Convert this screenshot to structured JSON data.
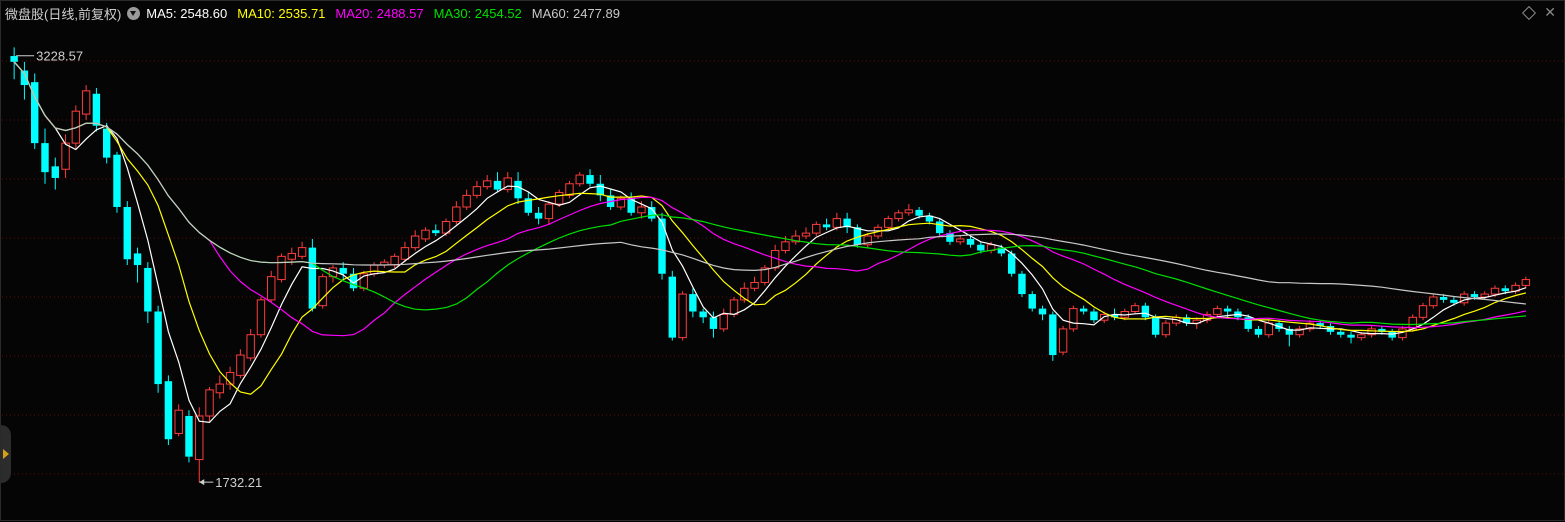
{
  "header": {
    "title": "微盘股(日线,前复权)",
    "ma": [
      {
        "label": "MA5: 2548.60",
        "color": "#ffffff"
      },
      {
        "label": "MA10: 2535.71",
        "color": "#ffff00"
      },
      {
        "label": "MA20: 2488.57",
        "color": "#ff00ff"
      },
      {
        "label": "MA30: 2454.52",
        "color": "#00e000"
      },
      {
        "label": "MA60: 2477.89",
        "color": "#c8c8c8"
      }
    ]
  },
  "chart_data": {
    "type": "candlestick",
    "ylim": [
      1650,
      3300
    ],
    "grid": true,
    "colors": {
      "up": "#ff3c3c",
      "down": "#00ffff"
    },
    "annotations": {
      "high": "3228.57",
      "low": "1732.21"
    },
    "high_value": 3228.57,
    "low_value": 1732.21,
    "candles": [
      [
        3200,
        3180,
        3230,
        3120
      ],
      [
        3150,
        3100,
        3180,
        3050
      ],
      [
        3110,
        2900,
        3140,
        2880
      ],
      [
        2900,
        2800,
        2950,
        2760
      ],
      [
        2820,
        2780,
        2850,
        2740
      ],
      [
        2810,
        2900,
        2930,
        2780
      ],
      [
        2900,
        3010,
        3030,
        2880
      ],
      [
        3000,
        3080,
        3100,
        2980
      ],
      [
        3070,
        2960,
        3090,
        2940
      ],
      [
        2950,
        2850,
        2970,
        2830
      ],
      [
        2860,
        2680,
        2870,
        2660
      ],
      [
        2680,
        2500,
        2700,
        2480
      ],
      [
        2520,
        2480,
        2540,
        2420
      ],
      [
        2470,
        2320,
        2490,
        2280
      ],
      [
        2320,
        2070,
        2340,
        2040
      ],
      [
        2080,
        1880,
        2100,
        1860
      ],
      [
        1900,
        1980,
        2000,
        1890
      ],
      [
        1960,
        1820,
        1980,
        1800
      ],
      [
        1810,
        1960,
        1990,
        1732.21
      ],
      [
        1960,
        2050,
        2060,
        1940
      ],
      [
        2040,
        2070,
        2100,
        2020
      ],
      [
        2070,
        2110,
        2130,
        2050
      ],
      [
        2100,
        2170,
        2190,
        2090
      ],
      [
        2160,
        2240,
        2260,
        2150
      ],
      [
        2240,
        2360,
        2370,
        2230
      ],
      [
        2360,
        2440,
        2460,
        2350
      ],
      [
        2430,
        2510,
        2520,
        2420
      ],
      [
        2500,
        2520,
        2540,
        2480
      ],
      [
        2510,
        2540,
        2560,
        2500
      ],
      [
        2540,
        2330,
        2570,
        2320
      ],
      [
        2340,
        2440,
        2450,
        2330
      ],
      [
        2440,
        2470,
        2480,
        2420
      ],
      [
        2470,
        2450,
        2490,
        2430
      ],
      [
        2450,
        2400,
        2470,
        2390
      ],
      [
        2400,
        2450,
        2460,
        2390
      ],
      [
        2450,
        2480,
        2490,
        2440
      ],
      [
        2480,
        2490,
        2500,
        2470
      ],
      [
        2480,
        2510,
        2520,
        2470
      ],
      [
        2500,
        2540,
        2560,
        2490
      ],
      [
        2540,
        2580,
        2600,
        2530
      ],
      [
        2570,
        2600,
        2610,
        2560
      ],
      [
        2600,
        2590,
        2620,
        2580
      ],
      [
        2590,
        2630,
        2640,
        2580
      ],
      [
        2630,
        2680,
        2700,
        2620
      ],
      [
        2680,
        2720,
        2740,
        2670
      ],
      [
        2720,
        2750,
        2770,
        2710
      ],
      [
        2750,
        2770,
        2790,
        2740
      ],
      [
        2770,
        2740,
        2800,
        2730
      ],
      [
        2740,
        2780,
        2800,
        2730
      ],
      [
        2770,
        2710,
        2800,
        2690
      ],
      [
        2710,
        2660,
        2730,
        2650
      ],
      [
        2660,
        2640,
        2680,
        2620
      ],
      [
        2640,
        2690,
        2700,
        2620
      ],
      [
        2690,
        2730,
        2740,
        2680
      ],
      [
        2720,
        2760,
        2770,
        2710
      ],
      [
        2760,
        2790,
        2800,
        2750
      ],
      [
        2790,
        2760,
        2810,
        2750
      ],
      [
        2760,
        2720,
        2790,
        2700
      ],
      [
        2720,
        2680,
        2740,
        2670
      ],
      [
        2680,
        2710,
        2720,
        2670
      ],
      [
        2710,
        2660,
        2730,
        2650
      ],
      [
        2660,
        2680,
        2700,
        2640
      ],
      [
        2680,
        2640,
        2700,
        2630
      ],
      [
        2640,
        2450,
        2660,
        2430
      ],
      [
        2440,
        2230,
        2460,
        2220
      ],
      [
        2230,
        2380,
        2390,
        2220
      ],
      [
        2380,
        2320,
        2400,
        2300
      ],
      [
        2320,
        2300,
        2330,
        2280
      ],
      [
        2300,
        2260,
        2320,
        2230
      ],
      [
        2260,
        2310,
        2330,
        2250
      ],
      [
        2310,
        2360,
        2370,
        2300
      ],
      [
        2360,
        2400,
        2420,
        2350
      ],
      [
        2400,
        2420,
        2440,
        2390
      ],
      [
        2420,
        2470,
        2480,
        2410
      ],
      [
        2470,
        2530,
        2550,
        2460
      ],
      [
        2530,
        2560,
        2580,
        2520
      ],
      [
        2560,
        2580,
        2600,
        2550
      ],
      [
        2580,
        2590,
        2610,
        2570
      ],
      [
        2590,
        2620,
        2630,
        2580
      ],
      [
        2620,
        2610,
        2640,
        2600
      ],
      [
        2610,
        2640,
        2660,
        2600
      ],
      [
        2640,
        2610,
        2660,
        2590
      ],
      [
        2610,
        2550,
        2620,
        2540
      ],
      [
        2550,
        2580,
        2590,
        2540
      ],
      [
        2580,
        2610,
        2620,
        2570
      ],
      [
        2610,
        2640,
        2650,
        2600
      ],
      [
        2640,
        2660,
        2670,
        2630
      ],
      [
        2660,
        2670,
        2690,
        2650
      ],
      [
        2670,
        2650,
        2680,
        2640
      ],
      [
        2650,
        2630,
        2660,
        2620
      ],
      [
        2630,
        2590,
        2640,
        2580
      ],
      [
        2590,
        2560,
        2600,
        2550
      ],
      [
        2560,
        2570,
        2580,
        2550
      ],
      [
        2570,
        2550,
        2580,
        2540
      ],
      [
        2550,
        2530,
        2560,
        2520
      ],
      [
        2530,
        2550,
        2560,
        2520
      ],
      [
        2540,
        2520,
        2550,
        2510
      ],
      [
        2520,
        2450,
        2530,
        2440
      ],
      [
        2450,
        2380,
        2460,
        2370
      ],
      [
        2380,
        2330,
        2390,
        2320
      ],
      [
        2330,
        2310,
        2340,
        2290
      ],
      [
        2310,
        2170,
        2320,
        2150
      ],
      [
        2180,
        2260,
        2270,
        2170
      ],
      [
        2260,
        2330,
        2340,
        2250
      ],
      [
        2330,
        2320,
        2340,
        2310
      ],
      [
        2320,
        2290,
        2330,
        2280
      ],
      [
        2290,
        2310,
        2320,
        2280
      ],
      [
        2310,
        2300,
        2330,
        2290
      ],
      [
        2300,
        2320,
        2330,
        2290
      ],
      [
        2320,
        2340,
        2350,
        2310
      ],
      [
        2340,
        2300,
        2350,
        2290
      ],
      [
        2300,
        2240,
        2310,
        2230
      ],
      [
        2240,
        2280,
        2290,
        2230
      ],
      [
        2280,
        2300,
        2310,
        2270
      ],
      [
        2300,
        2280,
        2310,
        2270
      ],
      [
        2280,
        2290,
        2300,
        2260
      ],
      [
        2290,
        2310,
        2320,
        2280
      ],
      [
        2310,
        2330,
        2340,
        2300
      ],
      [
        2330,
        2320,
        2340,
        2300
      ],
      [
        2320,
        2300,
        2330,
        2290
      ],
      [
        2300,
        2260,
        2310,
        2250
      ],
      [
        2260,
        2240,
        2270,
        2230
      ],
      [
        2240,
        2280,
        2290,
        2230
      ],
      [
        2280,
        2260,
        2290,
        2250
      ],
      [
        2260,
        2240,
        2270,
        2200
      ],
      [
        2240,
        2260,
        2270,
        2230
      ],
      [
        2260,
        2280,
        2290,
        2250
      ],
      [
        2280,
        2270,
        2290,
        2260
      ],
      [
        2270,
        2250,
        2280,
        2240
      ],
      [
        2250,
        2240,
        2260,
        2230
      ],
      [
        2240,
        2230,
        2250,
        2210
      ],
      [
        2230,
        2240,
        2250,
        2220
      ],
      [
        2240,
        2260,
        2270,
        2230
      ],
      [
        2260,
        2250,
        2270,
        2240
      ],
      [
        2250,
        2230,
        2260,
        2220
      ],
      [
        2230,
        2260,
        2270,
        2220
      ],
      [
        2260,
        2300,
        2310,
        2250
      ],
      [
        2300,
        2340,
        2350,
        2290
      ],
      [
        2340,
        2370,
        2380,
        2330
      ],
      [
        2370,
        2360,
        2380,
        2350
      ],
      [
        2360,
        2350,
        2370,
        2340
      ],
      [
        2350,
        2380,
        2390,
        2340
      ],
      [
        2380,
        2370,
        2390,
        2360
      ],
      [
        2370,
        2380,
        2390,
        2360
      ],
      [
        2380,
        2400,
        2410,
        2370
      ],
      [
        2400,
        2390,
        2410,
        2380
      ],
      [
        2390,
        2410,
        2420,
        2380
      ],
      [
        2410,
        2430,
        2440,
        2400
      ]
    ]
  }
}
